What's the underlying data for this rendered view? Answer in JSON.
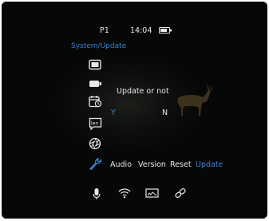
{
  "status_bar": {
    "profile": "P1",
    "time": "14:04",
    "battery_icon": "battery-icon"
  },
  "breadcrumb": "System/Update",
  "side_menu": [
    {
      "name": "display-icon"
    },
    {
      "name": "camera-icon"
    },
    {
      "name": "calendar-clock-icon"
    },
    {
      "name": "language-icon"
    },
    {
      "name": "aperture-icon"
    },
    {
      "name": "wrench-icon",
      "active": true
    }
  ],
  "dialog": {
    "title": "Update or not",
    "yes_label": "Y",
    "no_label": "N"
  },
  "sub_tabs": [
    {
      "label": "Audio"
    },
    {
      "label": "Version"
    },
    {
      "label": "Reset"
    },
    {
      "label": "Update",
      "active": true
    }
  ],
  "bottom_bar": [
    {
      "name": "microphone-icon"
    },
    {
      "name": "wifi-icon"
    },
    {
      "name": "screen-record-icon"
    },
    {
      "name": "link-icon"
    }
  ],
  "colors": {
    "accent": "#3d82d6",
    "text": "#e6e6e6",
    "background": "#0b0c0b"
  }
}
